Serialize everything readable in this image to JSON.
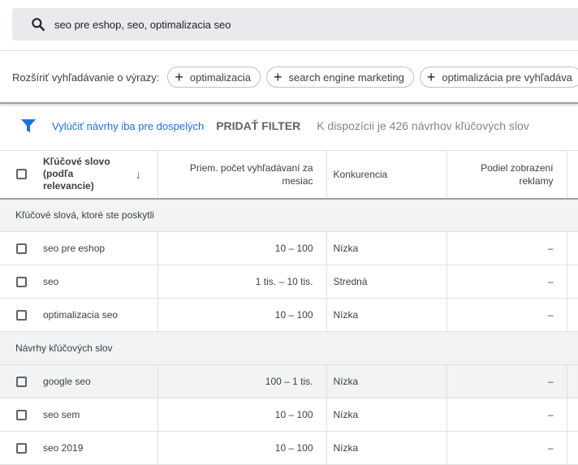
{
  "search": {
    "query": "seo pre eshop, seo, optimalizacia seo",
    "icon": "search-icon"
  },
  "expand": {
    "label": "Rozšíriť vyhľadávanie o výrazy:",
    "chips": [
      "optimalizacia",
      "search engine marketing",
      "optimalizácia pre vyhľadáva"
    ]
  },
  "filters": {
    "exclude_adult": "Vylúčiť návrhy iba pre dospelých",
    "add_filter": "PRIDAŤ FILTER",
    "count": "K dispozícii je 426 návrhov kľúčových slov",
    "accent": "#1a73e8"
  },
  "table": {
    "headers": {
      "keyword": "Kľúčové slovo (podľa relevancie)",
      "searches": "Priem. počet vyhľadávaní za mesiac",
      "competition": "Konkurencia",
      "impression_share": "Podiel zobrazení reklamy"
    },
    "groups": [
      {
        "title": "Kľúčové slová, ktoré ste poskytli",
        "rows": [
          {
            "keyword": "seo pre eshop",
            "searches": "10 – 100",
            "competition": "Nízka",
            "share": "–"
          },
          {
            "keyword": "seo",
            "searches": "1 tis. – 10 tis.",
            "competition": "Stredná",
            "share": "–"
          },
          {
            "keyword": "optimalizacia seo",
            "searches": "10 – 100",
            "competition": "Nízka",
            "share": "–"
          }
        ]
      },
      {
        "title": "Návrhy kľúčových slov",
        "rows": [
          {
            "keyword": "google seo",
            "searches": "100 – 1 tis.",
            "competition": "Nízka",
            "share": "–"
          },
          {
            "keyword": "seo sem",
            "searches": "10 – 100",
            "competition": "Nízka",
            "share": "–"
          },
          {
            "keyword": "seo 2019",
            "searches": "10 – 100",
            "competition": "Nízka",
            "share": "–"
          }
        ]
      }
    ]
  }
}
